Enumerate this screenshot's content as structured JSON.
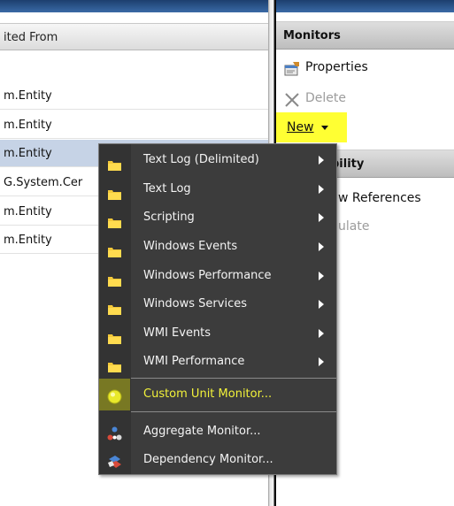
{
  "left": {
    "header": "ited From",
    "rows": [
      "m.Entity",
      "m.Entity",
      "m.Entity",
      "G.System.Cer",
      "m.Entity",
      "m.Entity"
    ],
    "selected_row_index": 2
  },
  "actions": {
    "section_title": "Monitors",
    "properties": "Properties",
    "delete": "Delete",
    "new": "New",
    "section2_partial": "bility",
    "view_references_partial": "w References",
    "simulate_partial": "ulate"
  },
  "menu": {
    "items": [
      {
        "label": "Text Log (Delimited)",
        "icon": "folder-icon",
        "submenu": true
      },
      {
        "label": "Text Log",
        "icon": "folder-icon",
        "submenu": true
      },
      {
        "label": "Scripting",
        "icon": "folder-icon",
        "submenu": true
      },
      {
        "label": "Windows Events",
        "icon": "folder-icon",
        "submenu": true
      },
      {
        "label": "Windows Performance",
        "icon": "folder-icon",
        "submenu": true
      },
      {
        "label": "Windows Services",
        "icon": "folder-icon",
        "submenu": true
      },
      {
        "label": "WMI Events",
        "icon": "folder-icon",
        "submenu": true
      },
      {
        "label": "WMI Performance",
        "icon": "folder-icon",
        "submenu": true
      },
      {
        "label": "Custom Unit Monitor...",
        "icon": "unit-monitor-icon",
        "highlighted": true
      },
      {
        "label": "Aggregate Monitor...",
        "icon": "aggregate-monitor-icon"
      },
      {
        "label": "Dependency Monitor...",
        "icon": "dependency-monitor-icon"
      }
    ]
  },
  "colors": {
    "menu_bg": "#3c3c3c",
    "highlight_text": "#f2f23a",
    "new_highlight": "#ffff33",
    "selected_row": "#c6d3e6"
  }
}
